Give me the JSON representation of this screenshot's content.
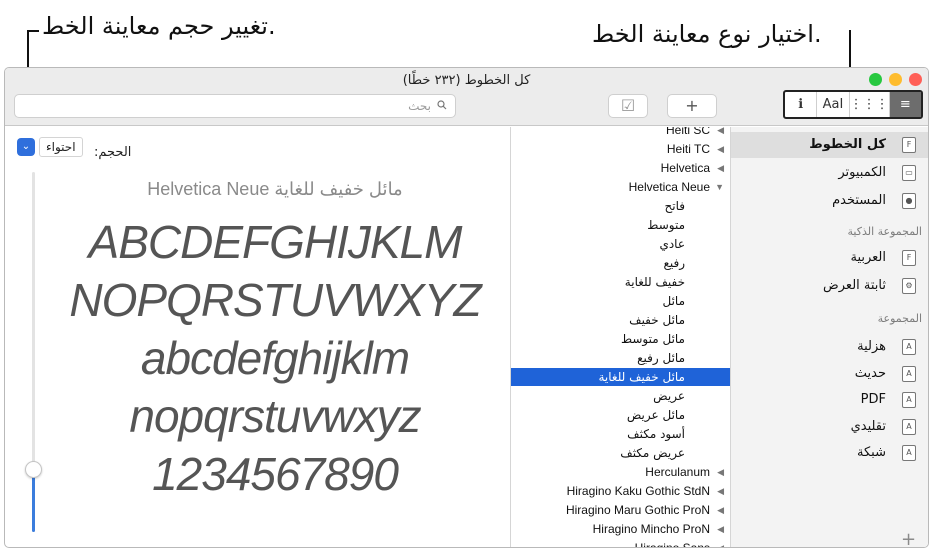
{
  "callouts": {
    "left": "تغيير حجم معاينة الخط.",
    "right": "اختيار نوع معاينة الخط."
  },
  "window": {
    "title": "كل الخطوط (٢٣٢ خطًا)",
    "search_placeholder": "بحث",
    "toolbar": {
      "add_label": "+",
      "check_label": "☑"
    },
    "preview_modes": [
      "ℹ",
      "AaI",
      "⋮⋮⋮",
      "≡"
    ]
  },
  "preview": {
    "size_label": "الحجم:",
    "size_value": "احتواء",
    "font_name": "Helvetica Neue مائل خفيف للغاية",
    "samples": [
      "ABCDEFGHIJKLM",
      "NOPQRSTUVWXYZ",
      "abcdefghijklm",
      "nopqrstuvwxyz",
      "1234567890"
    ],
    "slider_fraction": 0.18
  },
  "fonts_list": [
    {
      "label": "Heiti SC",
      "kind": "family",
      "tri": "◀"
    },
    {
      "label": "Heiti TC",
      "kind": "family",
      "tri": "◀"
    },
    {
      "label": "Helvetica",
      "kind": "family",
      "tri": "◀"
    },
    {
      "label": "Helvetica Neue",
      "kind": "family",
      "tri": "▼"
    },
    {
      "label": "فاتح",
      "kind": "style"
    },
    {
      "label": "متوسط",
      "kind": "style"
    },
    {
      "label": "عادي",
      "kind": "style"
    },
    {
      "label": "رفيع",
      "kind": "style"
    },
    {
      "label": "خفيف للغاية",
      "kind": "style"
    },
    {
      "label": "مائل",
      "kind": "style"
    },
    {
      "label": "مائل خفيف",
      "kind": "style"
    },
    {
      "label": "مائل متوسط",
      "kind": "style"
    },
    {
      "label": "مائل رفيع",
      "kind": "style"
    },
    {
      "label": "مائل خفيف للغاية",
      "kind": "style",
      "selected": true
    },
    {
      "label": "عريض",
      "kind": "style"
    },
    {
      "label": "مائل عريض",
      "kind": "style"
    },
    {
      "label": "أسود مكثف",
      "kind": "style"
    },
    {
      "label": "عريض مكثف",
      "kind": "style"
    },
    {
      "label": "Herculanum",
      "kind": "family",
      "tri": "◀"
    },
    {
      "label": "Hiragino Kaku Gothic StdN",
      "kind": "family",
      "tri": "◀"
    },
    {
      "label": "Hiragino Maru Gothic ProN",
      "kind": "family",
      "tri": "◀"
    },
    {
      "label": "Hiragino Mincho ProN",
      "kind": "family",
      "tri": "◀"
    },
    {
      "label": "Hiragino Sans",
      "kind": "family",
      "tri": "◀"
    }
  ],
  "sidebar": {
    "items_top": [
      {
        "label": "كل الخطوط",
        "icon": "F",
        "active": true
      },
      {
        "label": "الكمبيوتر",
        "icon": "▭"
      },
      {
        "label": "المستخدم",
        "icon": "●"
      }
    ],
    "smart_header": "المجموعة الذكية",
    "smart_items": [
      {
        "label": "العربية",
        "icon": "F"
      },
      {
        "label": "ثابتة العرض",
        "icon": "⚙"
      }
    ],
    "collection_header": "المجموعة",
    "collection_items": [
      {
        "label": "هزلية",
        "icon": "A"
      },
      {
        "label": "حديث",
        "icon": "A"
      },
      {
        "label": "PDF",
        "icon": "A"
      },
      {
        "label": "تقليدي",
        "icon": "A"
      },
      {
        "label": "شبكة",
        "icon": "A"
      }
    ],
    "add_label": "+"
  },
  "colors": {
    "accent": "#1f63d8",
    "close": "#ff5f57",
    "minimize": "#febc2e",
    "zoom": "#28c840"
  }
}
